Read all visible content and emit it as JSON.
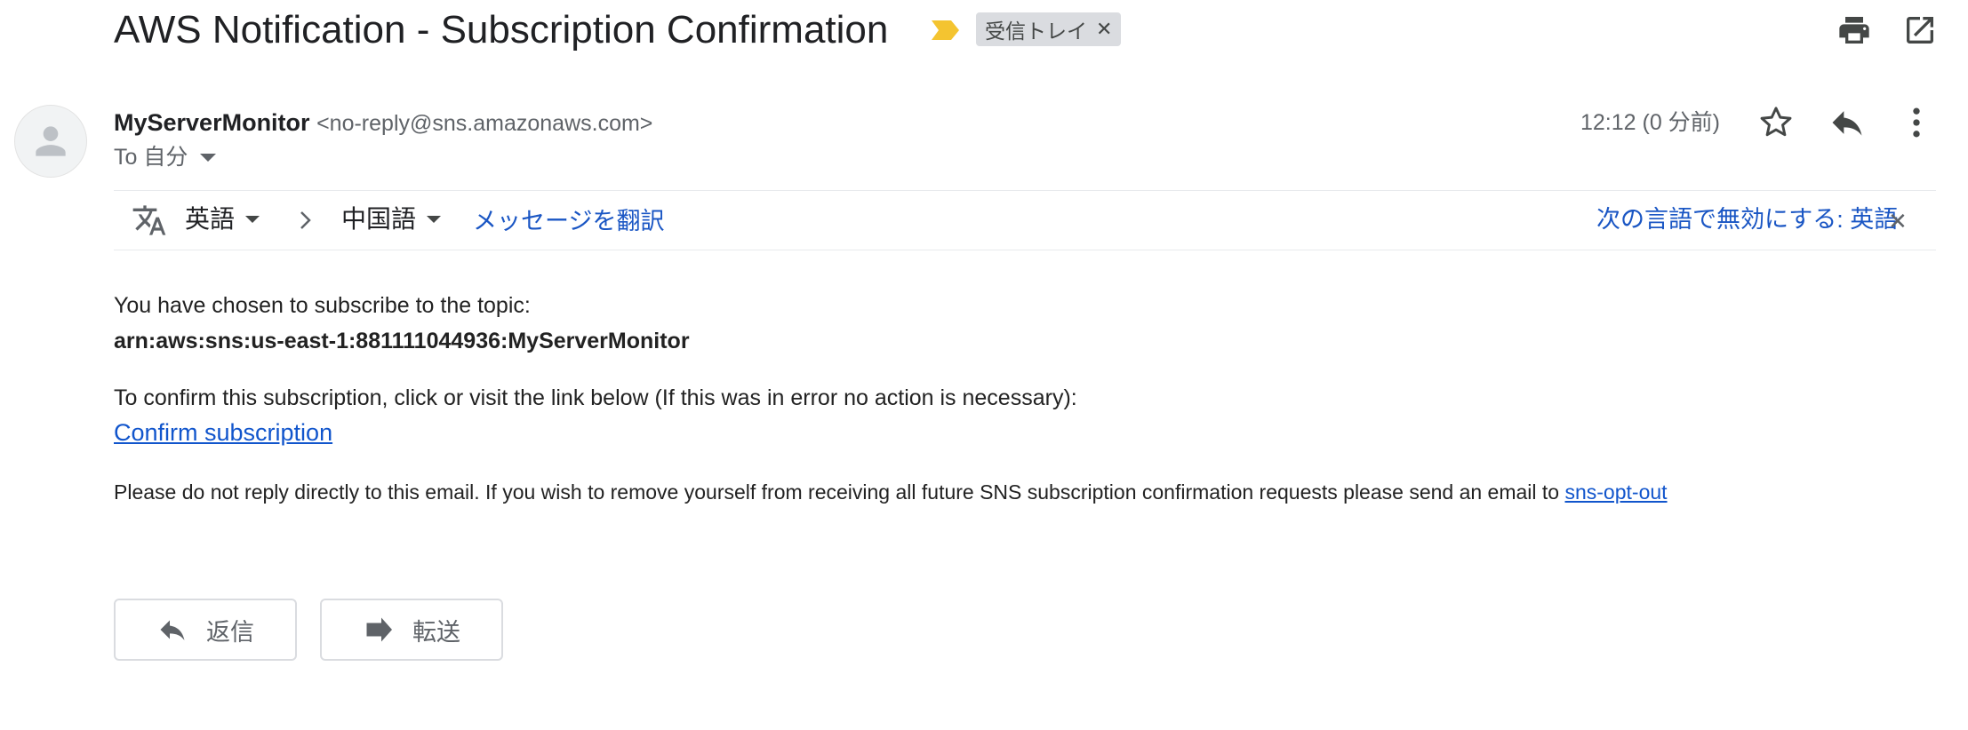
{
  "email": {
    "subject": "AWS Notification - Subscription Confirmation",
    "label": "受信トレイ",
    "sender_name": "MyServerMonitor",
    "sender_email": "<no-reply@sns.amazonaws.com>",
    "to_line": "To 自分",
    "timestamp": "12:12 (0 分前)"
  },
  "translate": {
    "source_lang": "英語",
    "target_lang": "中国語",
    "translate_link": "メッセージを翻訳",
    "disable_link": "次の言語で無効にする: 英語"
  },
  "body": {
    "p1": "You have chosen to subscribe to the topic:",
    "topic_arn": "arn:aws:sns:us-east-1:881111044936:MyServerMonitor",
    "p2": "To confirm this subscription, click or visit the link below (If this was in error no action is necessary):",
    "confirm_link": "Confirm subscription",
    "p3": "Please do not reply directly to this email. If you wish to remove yourself from receiving all future SNS subscription confirmation requests please send an email to ",
    "opt_out_link": "sns-opt-out"
  },
  "actions": {
    "reply_label": "返信",
    "forward_label": "転送"
  },
  "icons": {
    "importance": "importance-marker-icon",
    "print": "print-icon",
    "popout": "open-in-new-window-icon",
    "avatar": "default-avatar-icon",
    "star": "star-icon",
    "reply": "reply-icon",
    "more": "more-vert-icon",
    "translate": "translate-icon",
    "forward": "forward-icon"
  },
  "colors": {
    "link": "#1a56c4",
    "importance": "#f4c430",
    "label_chip": "#dadce0"
  }
}
